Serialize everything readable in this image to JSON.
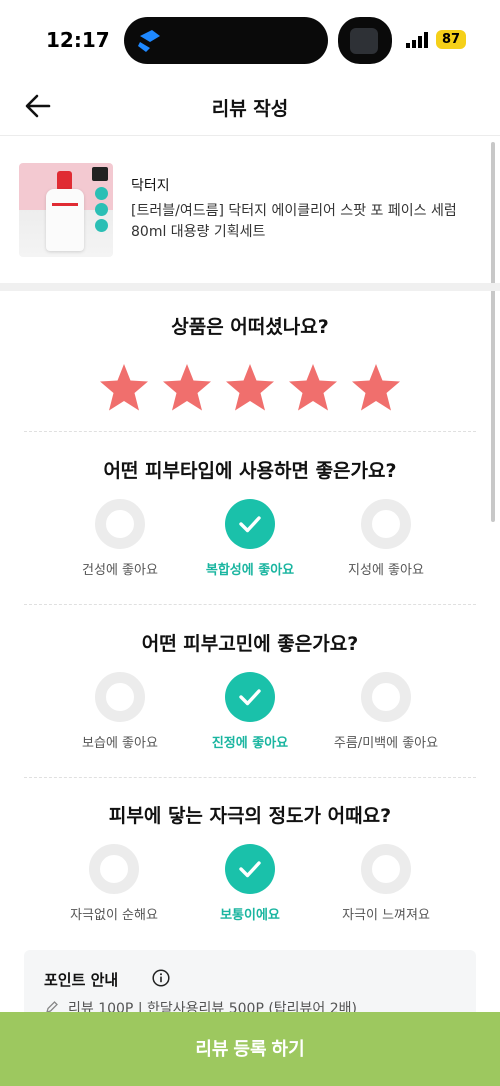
{
  "status_bar": {
    "time": "12:17",
    "battery": "87"
  },
  "header": {
    "title": "리뷰 작성"
  },
  "product": {
    "brand": "닥터지",
    "name": "[트러블/여드름] 닥터지 에이클리어 스팟 포 페이스 세럼 80ml 대용량 기획세트"
  },
  "rating": {
    "question": "상품은 어떠셨나요?",
    "stars": 5,
    "max_stars": 5,
    "star_color": "#f06f6d"
  },
  "skin_type": {
    "question": "어떤 피부타입에 사용하면 좋은가요?",
    "options": [
      {
        "label": "건성에 좋아요",
        "selected": false
      },
      {
        "label": "복합성에 좋아요",
        "selected": true
      },
      {
        "label": "지성에 좋아요",
        "selected": false
      }
    ]
  },
  "skin_concern": {
    "question": "어떤 피부고민에 좋은가요?",
    "options": [
      {
        "label": "보습에 좋아요",
        "selected": false
      },
      {
        "label": "진정에 좋아요",
        "selected": true
      },
      {
        "label": "주름/미백에 좋아요",
        "selected": false
      }
    ]
  },
  "irritation": {
    "question": "피부에 닿는 자극의 정도가 어때요?",
    "options": [
      {
        "label": "자극없이 순해요",
        "selected": false
      },
      {
        "label": "보통이에요",
        "selected": true
      },
      {
        "label": "자극이 느껴져요",
        "selected": false
      }
    ]
  },
  "points": {
    "title": "포인트 안내",
    "detail": "리뷰 100P | 한달사용리뷰 500P (탑리뷰어 2배)"
  },
  "submit_label": "리뷰 등록 하기",
  "colors": {
    "accent": "#1ac1aa",
    "submit": "#9dc85f",
    "star": "#f06f6d"
  },
  "icons": [
    "back-arrow-icon",
    "check-icon",
    "star-icon",
    "info-icon",
    "pencil-icon",
    "signal-icon"
  ]
}
